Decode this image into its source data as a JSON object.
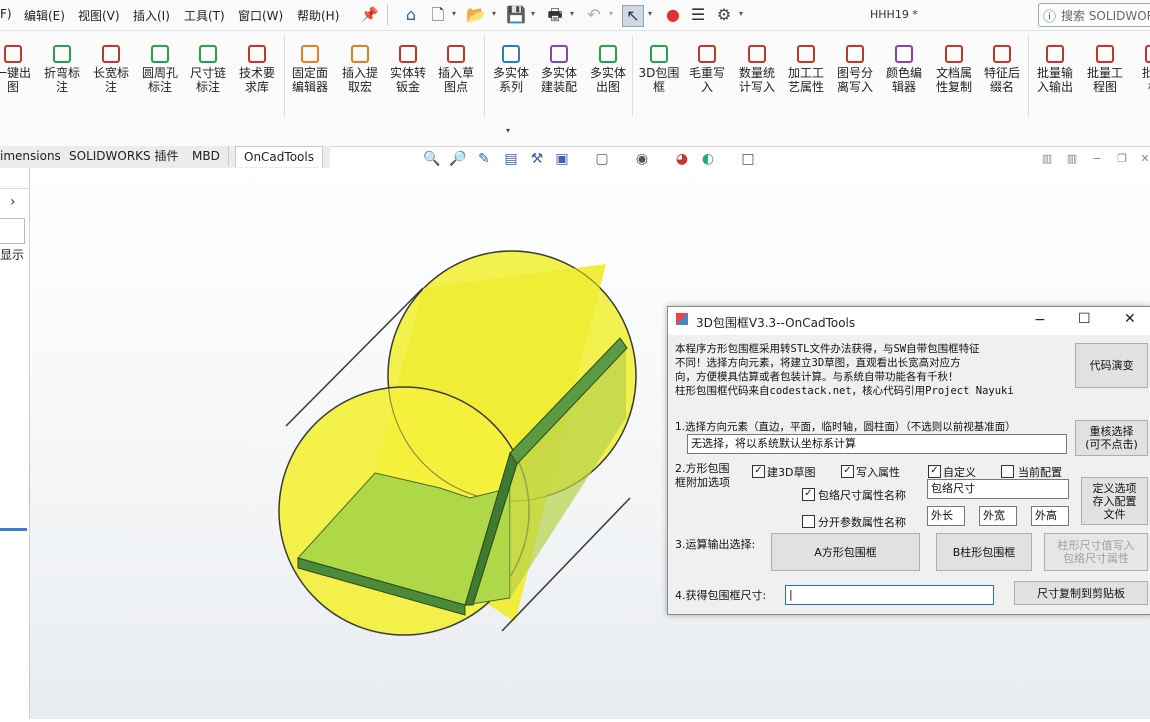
{
  "menu": {
    "items": [
      "F)",
      "编辑(E)",
      "视图(V)",
      "插入(I)",
      "工具(T)",
      "窗口(W)",
      "帮助(H)"
    ]
  },
  "quick_access": {
    "icons": [
      "pin-icon",
      "home-icon",
      "new-document-icon",
      "open-icon",
      "save-icon",
      "print-icon",
      "undo-icon",
      "select-icon",
      "traffic-light-icon",
      "file-properties-icon",
      "options-gear-icon"
    ]
  },
  "document_title": "HHH19 *",
  "search": {
    "placeholder": "搜索 SOLIDWORKS"
  },
  "ribbon": {
    "buttons": [
      {
        "label": "一键出\n图",
        "color": "#c0392b"
      },
      {
        "label": "折弯标\n注",
        "color": "#27a34a"
      },
      {
        "label": "长宽标\n注",
        "color": "#c0392b"
      },
      {
        "label": "圆周孔\n标注",
        "color": "#27a34a"
      },
      {
        "label": "尺寸链\n标注",
        "color": "#27a34a"
      },
      {
        "label": "技术要\n求库",
        "color": "#c0392b"
      },
      {
        "label": "固定面\n编辑器",
        "color": "#e67e22"
      },
      {
        "label": "插入提\n取宏",
        "color": "#e67e22"
      },
      {
        "label": "实体转\n钣金",
        "color": "#c0392b"
      },
      {
        "label": "插入草\n图点",
        "color": "#c0392b"
      },
      {
        "label": "多实体\n系列",
        "color": "#2980b9"
      },
      {
        "label": "多实体\n建装配",
        "color": "#8e44ad"
      },
      {
        "label": "多实体\n出图",
        "color": "#27a34a"
      },
      {
        "label": "3D包围\n框",
        "color": "#27a34a"
      },
      {
        "label": "毛重写\n入",
        "color": "#c0392b"
      },
      {
        "label": "数量统\n计写入",
        "color": "#c0392b"
      },
      {
        "label": "加工工\n艺属性",
        "color": "#c0392b"
      },
      {
        "label": "图号分\n离写入",
        "color": "#c0392b"
      },
      {
        "label": "颜色编\n辑器",
        "color": "#8e44ad"
      },
      {
        "label": "文档属\n性复制",
        "color": "#c0392b"
      },
      {
        "label": "特征后\n缀名",
        "color": "#c0392b"
      },
      {
        "label": "批量输\n入输出",
        "color": "#c0392b"
      },
      {
        "label": "批量工\n程图",
        "color": "#c0392b"
      },
      {
        "label": "批量\n标",
        "color": "#c0392b"
      }
    ]
  },
  "tabs": [
    "imensions",
    "SOLIDWORKS 插件",
    "MBD",
    "OnCadTools"
  ],
  "left_panel": {
    "label": "显示"
  },
  "dialog": {
    "title": "3D包围框V3.3--OnCadTools",
    "description": [
      "本程序方形包围框采用转STL文件办法获得，与SW自带包围框特征",
      "不同！选择方向元素，将建立3D草图，直观看出长宽高对应方",
      "向，方便模具估算或者包装计算。与系统自带功能各有千秋！",
      "柱形包围框代码来自codestack.net，核心代码引用Project Nayuki"
    ],
    "demo_button": "代码演变",
    "step1_label": "1.选择方向元素（直边，平面，临时轴，圆柱面）（不选则以前视基准面）",
    "step1_value": "无选择，将以系统默认坐标系计算",
    "reselect_button": "重核选择\n(可不点击)",
    "step2_label": "2.方形包围\n框附加选项",
    "opt_3d_sketch": "建3D草图",
    "opt_write_prop": "写入属性",
    "opt_custom": "自定义",
    "opt_current_config": "当前配置",
    "opt_prop_name": "包络尺寸属性名称",
    "prop_name_value": "包络尺寸",
    "opt_split": "分开参数属性名称",
    "split_len": "外长",
    "split_wid": "外宽",
    "split_hei": "外高",
    "save_config_button": "定义选项\n存入配置\n文件",
    "step3_label": "3.运算输出选择:",
    "box_a_button": "A方形包围框",
    "box_b_button": "B柱形包围框",
    "cyl_write_button": "柱形尺寸值写入\n包络尺寸属性",
    "step4_label": "4.获得包围框尺寸:",
    "result_value": "|",
    "copy_button": "尺寸复制到剪贴板",
    "checkbox_states": {
      "sketch3d": true,
      "write": true,
      "custom": true,
      "current": false,
      "propname": true,
      "split": false
    }
  }
}
